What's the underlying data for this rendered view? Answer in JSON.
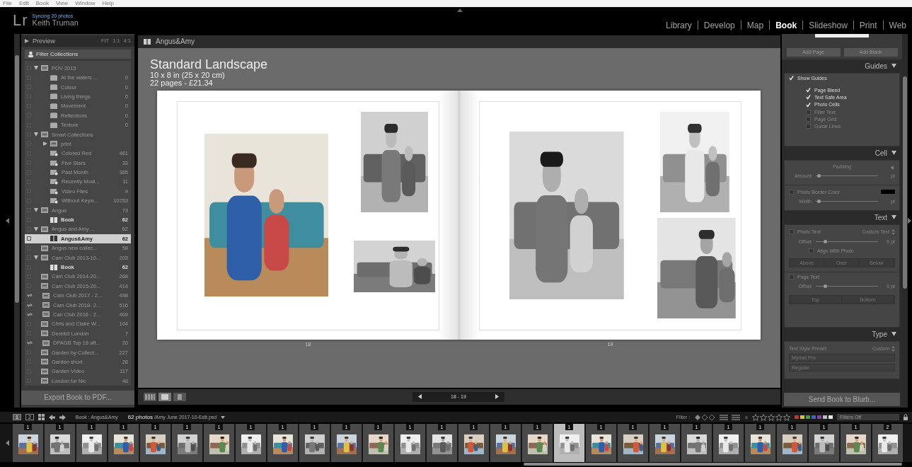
{
  "menu": [
    "File",
    "Edit",
    "Book",
    "View",
    "Window",
    "Help"
  ],
  "identity": {
    "logo": "Lr",
    "sync_status": "Syncing 20 photos",
    "user": "Keith Truman"
  },
  "modules": [
    {
      "label": "Library",
      "selected": false
    },
    {
      "label": "Develop",
      "selected": false
    },
    {
      "label": "Map",
      "selected": false
    },
    {
      "label": "Book",
      "selected": true
    },
    {
      "label": "Slideshow",
      "selected": false
    },
    {
      "label": "Print",
      "selected": false
    },
    {
      "label": "Web",
      "selected": false
    }
  ],
  "left_panel": {
    "preview": {
      "title": "Preview",
      "expanded": false,
      "zoom_options": [
        "FIT",
        "1:1",
        "4:1"
      ]
    },
    "filter": {
      "placeholder": "Filter Collections"
    },
    "collections": [
      {
        "name": "POV 2015",
        "kind": "set",
        "expanded": true,
        "selected": false,
        "synced": false,
        "children": [
          {
            "name": "At the waters ...",
            "count": "0",
            "kind": "collection",
            "selected": false,
            "synced": false
          },
          {
            "name": "Colour",
            "count": "0",
            "kind": "collection",
            "selected": false,
            "synced": false
          },
          {
            "name": "Living things",
            "count": "0",
            "kind": "collection",
            "selected": false,
            "synced": false
          },
          {
            "name": "Movement",
            "count": "0",
            "kind": "collection",
            "selected": false,
            "synced": false
          },
          {
            "name": "Reflections",
            "count": "0",
            "kind": "collection",
            "selected": false,
            "synced": false
          },
          {
            "name": "Texture",
            "count": "0",
            "kind": "collection",
            "selected": false,
            "synced": false
          }
        ]
      },
      {
        "name": "Smart Collections",
        "kind": "set",
        "expanded": true,
        "selected": false,
        "synced": false,
        "children": [
          {
            "name": "print",
            "kind": "set",
            "expanded": false,
            "selected": false,
            "synced": false
          },
          {
            "name": "Colored Red",
            "count": "461",
            "kind": "smart",
            "selected": false,
            "synced": false
          },
          {
            "name": "Five Stars",
            "count": "33",
            "kind": "smart",
            "selected": false,
            "synced": false
          },
          {
            "name": "Past Month",
            "count": "365",
            "kind": "smart",
            "selected": false,
            "synced": false
          },
          {
            "name": "Recently Modi...",
            "count": "11",
            "kind": "smart",
            "selected": false,
            "synced": false
          },
          {
            "name": "Video Files",
            "count": "9",
            "kind": "smart",
            "selected": false,
            "synced": false
          },
          {
            "name": "Without Keyw...",
            "count": "10253",
            "kind": "smart",
            "selected": false,
            "synced": false
          }
        ]
      },
      {
        "name": "Angus",
        "count": "73",
        "kind": "set",
        "expanded": true,
        "selected": false,
        "synced": false,
        "children": [
          {
            "name": "Book",
            "count": "62",
            "kind": "book",
            "selected": false,
            "synced": false
          }
        ]
      },
      {
        "name": "Angus and Amy ...",
        "count": "62",
        "kind": "set",
        "expanded": true,
        "selected": false,
        "synced": false,
        "children": [
          {
            "name": "Angus&Amy",
            "count": "62",
            "kind": "book",
            "selected": true,
            "synced": false
          }
        ]
      },
      {
        "name": "Angus new collec...",
        "count": "58",
        "kind": "set",
        "selected": false,
        "synced": false
      },
      {
        "name": "Cam Club 2013-10...",
        "count": "203",
        "kind": "set",
        "expanded": true,
        "selected": false,
        "synced": false,
        "children": [
          {
            "name": "Book",
            "count": "62",
            "kind": "book",
            "selected": false,
            "synced": false
          }
        ]
      },
      {
        "name": "Cam Club 2014-20...",
        "count": "268",
        "kind": "set",
        "selected": false,
        "synced": false
      },
      {
        "name": "Cam Club 2015-20...",
        "count": "414",
        "kind": "set",
        "selected": false,
        "synced": false
      },
      {
        "name": "Cam Club 2017 - 2...",
        "count": "498",
        "kind": "set",
        "selected": false,
        "synced": true
      },
      {
        "name": "Cam Club 2018- 2...",
        "count": "516",
        "kind": "set",
        "selected": false,
        "synced": true
      },
      {
        "name": "Can Club 2016 - 2...",
        "count": "469",
        "kind": "set",
        "selected": false,
        "synced": true
      },
      {
        "name": "Chris and Claire W...",
        "count": "104",
        "kind": "set",
        "selected": false,
        "synced": false
      },
      {
        "name": "Derelict London",
        "count": "7",
        "kind": "set",
        "selected": false,
        "synced": false
      },
      {
        "name": "DPAGB Top 18 aft...",
        "count": "20",
        "kind": "set",
        "selected": false,
        "synced": true
      },
      {
        "name": "Garden by Collect...",
        "count": "227",
        "kind": "set",
        "selected": false,
        "synced": false
      },
      {
        "name": "Garden short",
        "count": "28",
        "kind": "set",
        "selected": false,
        "synced": false
      },
      {
        "name": "Garden Video",
        "count": "117",
        "kind": "set",
        "selected": false,
        "synced": false
      },
      {
        "name": "London for Nic",
        "count": "48",
        "kind": "set",
        "selected": false,
        "synced": false
      }
    ],
    "export_button": "Export Book to PDF..."
  },
  "center": {
    "header": "Angus&Amy",
    "book": {
      "title": "Standard Landscape",
      "size": "10 x 8 in (25 x 20 cm)",
      "pages_price": "22 pages - £21.34"
    },
    "pages": [
      {
        "number": "18"
      },
      {
        "number": "19"
      }
    ],
    "view_modes": [
      {
        "selected": false
      },
      {
        "selected": true
      },
      {
        "selected": false
      }
    ],
    "page_nav": "18 - 19"
  },
  "right_panel": {
    "layout_buttons": [
      "Add Page",
      "Add Blank"
    ],
    "guides": {
      "title": "Guides",
      "expanded": true,
      "show_guides": {
        "label": "Show Guides",
        "checked": true
      },
      "options": [
        {
          "label": "Page Bleed",
          "checked": true
        },
        {
          "label": "Text Safe Area",
          "checked": true
        },
        {
          "label": "Photo Cells",
          "checked": true
        },
        {
          "label": "Filler Text",
          "checked": false
        },
        {
          "label": "Page Grid",
          "checked": false
        },
        {
          "label": "Guide Lines",
          "checked": false
        }
      ]
    },
    "cell": {
      "title": "Cell",
      "expanded": true,
      "padding_label": "Padding",
      "amount": {
        "label": "Amount",
        "level": 0.05,
        "unit": "pt"
      },
      "border": {
        "label": "Photo Border Color",
        "checked": false
      },
      "width": {
        "label": "Width",
        "level": 0.05,
        "unit": "pt"
      }
    },
    "text": {
      "title": "Text",
      "expanded": true,
      "photo_text": {
        "label": "Photo Text",
        "checked": false,
        "preset": "Custom Text"
      },
      "photo_offset": {
        "label": "Offset",
        "level": 0.15,
        "reading": "0 pt"
      },
      "align": {
        "label": "Align With Photo",
        "checked": false
      },
      "photo_positions": [
        {
          "label": "Above",
          "selected": false
        },
        {
          "label": "Over",
          "selected": false
        },
        {
          "label": "Below",
          "selected": false
        }
      ],
      "page_text": {
        "label": "Page Text",
        "checked": false
      },
      "page_offset": {
        "label": "Offset",
        "level": 0.15,
        "reading": "0 pt"
      },
      "page_positions": [
        {
          "label": "Top",
          "selected": false
        },
        {
          "label": "Bottom",
          "selected": false
        }
      ]
    },
    "type": {
      "title": "Type",
      "expanded": true,
      "preset_label": "Text Style Preset:",
      "preset": "Custom",
      "font": "Myriad Pro",
      "style": "Regular"
    },
    "send_button": "Send Book to Blurb..."
  },
  "filmstrip_bar": {
    "screens": [
      {
        "label": "1",
        "selected": true
      },
      {
        "label": "2",
        "selected": false
      }
    ],
    "source": "Book : Angus&Amy",
    "count": "62 photos",
    "file": "/Amy June 2017-10-Edit.psd",
    "filter_label": "Filter :",
    "rating_operator": "≥",
    "stars": 0,
    "color_labels": [
      {
        "color": "#c83232"
      },
      {
        "color": "#d6c43a"
      },
      {
        "color": "#3fa33f"
      },
      {
        "color": "#3b63c4"
      },
      {
        "color": "#8a3fa8"
      },
      {
        "color": "#bbbbbb"
      },
      {
        "color": "#e6e6e6"
      }
    ],
    "filter_preset": "Filters Off"
  },
  "filmstrip": [
    {
      "badge": "1",
      "selected": false
    },
    {
      "badge": "1",
      "selected": false
    },
    {
      "badge": "1",
      "selected": false
    },
    {
      "badge": "1",
      "selected": false
    },
    {
      "badge": "1",
      "selected": false
    },
    {
      "badge": "1",
      "selected": false
    },
    {
      "badge": "1",
      "selected": false
    },
    {
      "badge": "1",
      "selected": false
    },
    {
      "badge": "1",
      "selected": false
    },
    {
      "badge": "1",
      "selected": false
    },
    {
      "badge": "1",
      "selected": false
    },
    {
      "badge": "1",
      "selected": false
    },
    {
      "badge": "1",
      "selected": false
    },
    {
      "badge": "1",
      "selected": false
    },
    {
      "badge": "1",
      "selected": false
    },
    {
      "badge": "1",
      "selected": false
    },
    {
      "badge": "1",
      "selected": false
    },
    {
      "badge": "1",
      "selected": true
    },
    {
      "badge": "1",
      "selected": false
    },
    {
      "badge": "1",
      "selected": false
    },
    {
      "badge": "1",
      "selected": false
    },
    {
      "badge": "1",
      "selected": false
    },
    {
      "badge": "1",
      "selected": false
    },
    {
      "badge": "1",
      "selected": false
    },
    {
      "badge": "1",
      "selected": false
    },
    {
      "badge": "1",
      "selected": false
    },
    {
      "badge": "1",
      "selected": false
    },
    {
      "badge": "2",
      "selected": false
    }
  ]
}
